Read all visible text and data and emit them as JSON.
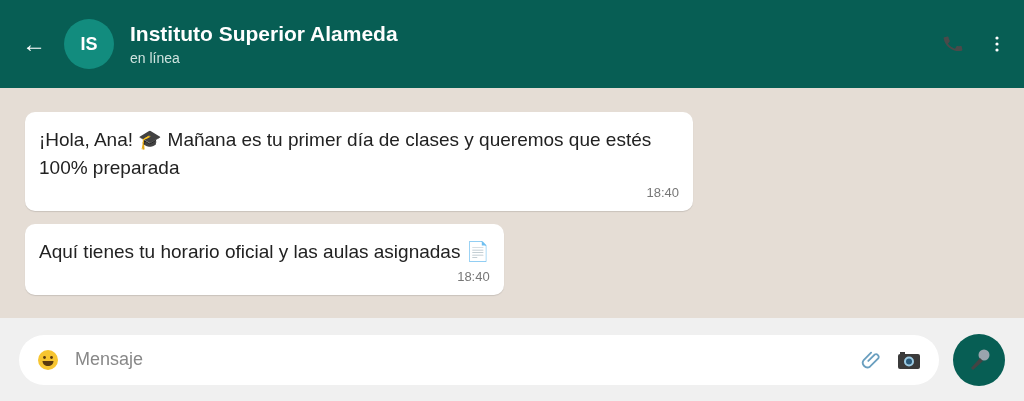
{
  "header": {
    "back": "←",
    "avatar_initials": "IS",
    "title": "Instituto Superior Alameda",
    "status": "en línea"
  },
  "messages": [
    {
      "text": "¡Hola, Ana! 🎓 Mañana es tu primer día de clases y queremos que estés 100% preparada",
      "time": "18:40"
    },
    {
      "text": "Aquí tienes tu horario oficial y las aulas asignadas 📄",
      "time": "18:40"
    }
  ],
  "composer": {
    "placeholder": "Mensaje"
  }
}
